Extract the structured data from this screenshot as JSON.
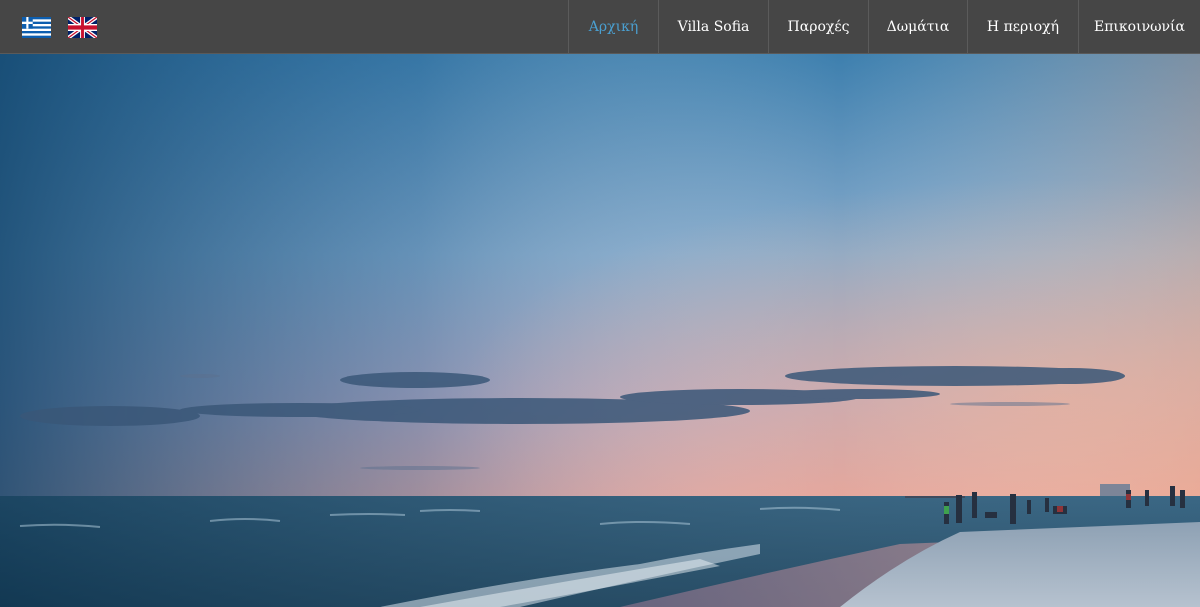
{
  "header": {
    "languages": [
      {
        "code": "el",
        "icon": "greek-flag-icon"
      },
      {
        "code": "en",
        "icon": "uk-flag-icon"
      }
    ],
    "nav": [
      {
        "label": "Αρχική",
        "active": true
      },
      {
        "label": "Villa Sofia",
        "active": false
      },
      {
        "label": "Παροχές",
        "active": false
      },
      {
        "label": "Δωμάτια",
        "active": false
      },
      {
        "label": "Η περιοχή",
        "active": false
      },
      {
        "label": "Επικοινωνία",
        "active": false
      }
    ]
  },
  "hero": {
    "image": "sunset-beach-photo"
  },
  "colors": {
    "topbar_bg": "#464646",
    "nav_active": "#4a9fd0",
    "nav_text": "#ffffff"
  }
}
